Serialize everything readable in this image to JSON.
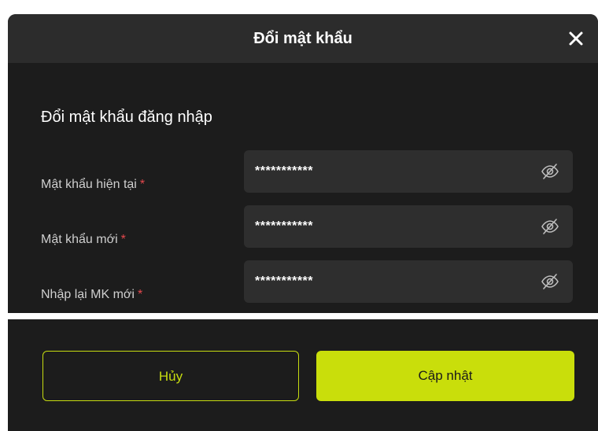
{
  "dialog": {
    "title": "Đổi mật khẩu",
    "section_title": "Đổi mật khẩu đăng nhập",
    "required_mark": "*",
    "fields": [
      {
        "label": "Mật khẩu hiện tại",
        "value": "***********",
        "icon": "eye-off-icon"
      },
      {
        "label": "Mật khẩu mới",
        "value": "***********",
        "icon": "eye-off-icon"
      },
      {
        "label": "Nhập lại MK mới",
        "value": "***********",
        "icon": "eye-off-icon"
      }
    ],
    "cancel_label": "Hủy",
    "update_label": "Cập nhật",
    "close_icon": "close-icon"
  },
  "colors": {
    "accent": "#c9de0b",
    "required": "#e5484d",
    "background": "#1c1c1c",
    "header": "#2c2c2c",
    "input_bg": "#2e2e2e"
  }
}
